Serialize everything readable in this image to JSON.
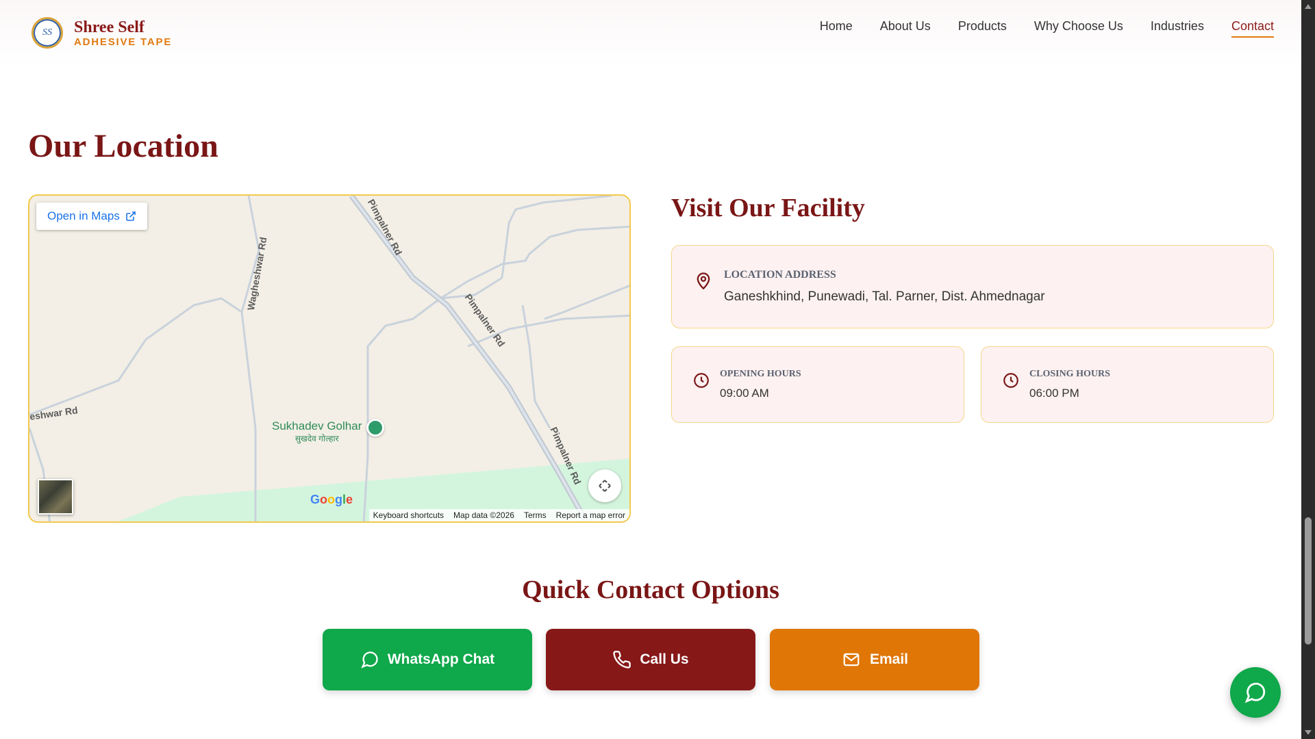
{
  "header": {
    "brand_name": "Shree Self",
    "brand_tagline": "ADHESIVE TAPE",
    "nav": [
      {
        "label": "Home"
      },
      {
        "label": "About Us"
      },
      {
        "label": "Products"
      },
      {
        "label": "Why Choose Us"
      },
      {
        "label": "Industries"
      },
      {
        "label": "Contact",
        "active": true
      }
    ]
  },
  "location": {
    "title": "Our Location",
    "map": {
      "open_in_maps": "Open in Maps",
      "roads": [
        "Wagheshwar Rd",
        "Pimpalner Rd",
        "Pimpalner Rd",
        "Pimpalner Rd",
        "eshwar Rd"
      ],
      "poi_name": "Sukhadev Golhar",
      "poi_local": "सुखदेव गोल्हार",
      "google": "Google",
      "footer": [
        "Keyboard shortcuts",
        "Map data ©2026",
        "Terms",
        "Report a map error"
      ]
    }
  },
  "facility": {
    "title": "Visit Our Facility",
    "address_label": "LOCATION ADDRESS",
    "address_value": "Ganeshkhind, Punewadi, Tal. Parner, Dist. Ahmednagar",
    "opening_label": "OPENING HOURS",
    "opening_value": "09:00 AM",
    "closing_label": "CLOSING HOURS",
    "closing_value": "06:00 PM"
  },
  "quick_contact": {
    "title": "Quick Contact Options",
    "whatsapp": "WhatsApp Chat",
    "call": "Call Us",
    "email": "Email"
  },
  "icons": {
    "location": "map-pin-icon",
    "clock": "clock-icon",
    "whatsapp": "message-circle-icon",
    "phone": "phone-icon",
    "mail": "mail-icon",
    "external": "external-link-icon",
    "fullscreen": "fullscreen-icon"
  },
  "colors": {
    "brand_maroon": "#7a1616",
    "accent_orange": "#e07a10",
    "whatsapp_green": "#0fa84a",
    "call_maroon": "#861818",
    "email_orange": "#e07606",
    "card_bg": "#fdf1f1",
    "card_border": "#f6d68a"
  }
}
